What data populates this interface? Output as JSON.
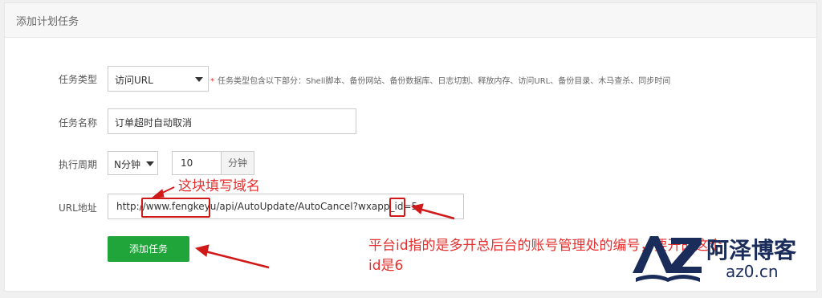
{
  "panel": {
    "title": "添加计划任务"
  },
  "form": {
    "task_type": {
      "label": "任务类型",
      "value": "访问URL",
      "hint_star": "*",
      "hint": "任务类型包含以下部分：Shell脚本、备份网站、备份数据库、日志切割、释放内存、访问URL、备份目录、木马查杀、同步时间"
    },
    "task_name": {
      "label": "任务名称",
      "value": "订单超时自动取消"
    },
    "period": {
      "label": "执行周期",
      "mode": "N分钟",
      "value": "10",
      "unit": "分钟"
    },
    "url": {
      "label": "URL地址",
      "prefix": "http://",
      "domain": "www.fengkeyu",
      "path": "/api/AutoUpdate/AutoCancel?wxapp_id=",
      "id": "5"
    },
    "submit": "添加任务"
  },
  "annotations": {
    "domain_note": "这块填写域名",
    "id_note_line1": "平台id指的是多开总后台的账号管理处的编号，要开的这个",
    "id_note_line2": "id是6"
  },
  "logo": {
    "mark": "AZ",
    "name": "阿泽博客",
    "site": "az0.cn"
  },
  "colors": {
    "primary_button": "#20a53a",
    "annotation_red": "#e52e2e",
    "logo_navy": "#1a2c5a"
  }
}
